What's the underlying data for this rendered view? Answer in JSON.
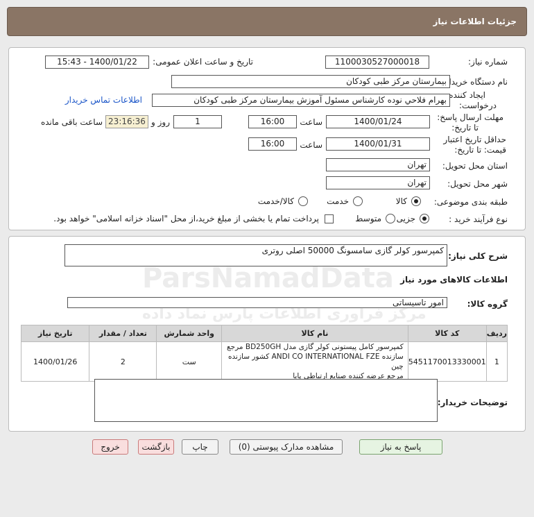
{
  "header": {
    "title": "جزئیات اطلاعات نیاز"
  },
  "form": {
    "need_number_label": "شماره نیاز:",
    "need_number": "1100030527000018",
    "announce_label": "تاریخ و ساعت اعلان عمومی:",
    "announce_value": "1400/01/22 - 15:43",
    "buyer_org_label": "نام دستگاه خریدار:",
    "buyer_org": "بیمارستان مرکز طبی کودکان",
    "creator_label_1": "ایجاد کننده",
    "creator_label_2": "درخواست:",
    "creator": "بهرام فلاحي نوده كارشناس مسئول آموزش بیمارستان مرکز طبی کودکان",
    "contact_link": "اطلاعات تماس خریدار",
    "deadline_label_1": "مهلت ارسال پاسخ:",
    "deadline_label_2": "تا تاریخ:",
    "deadline_date": "1400/01/24",
    "time_label": "ساعت",
    "deadline_time": "16:00",
    "days_value": "1",
    "days_label": "روز و",
    "remaining_value": "23:16:36",
    "remaining_label": "ساعت باقی مانده",
    "validity_label_1": "حداقل تاریخ اعتبار",
    "validity_label_2": "قیمت: تا تاریخ:",
    "validity_date": "1400/01/31",
    "validity_time": "16:00",
    "province_label": "استان محل تحویل:",
    "province": "تهران",
    "city_label": "شهر محل تحویل:",
    "city": "تهران",
    "category_label": "طبقه بندی موضوعی:",
    "category_options": [
      "کالا",
      "خدمت",
      "کالا/خدمت"
    ],
    "process_label": "نوع فرآیند خرید :",
    "process_options": [
      "جزیی",
      "متوسط"
    ],
    "payment_note": "پرداخت تمام یا بخشی از مبلغ خرید،از محل \"اسناد خزانه اسلامی\" خواهد بود."
  },
  "summary": {
    "desc_label": "شرح کلی نیاز:",
    "desc": "کمپرسور کولر گازی سامسونگ 50000 اصلی روتری",
    "items_title": "اطلاعات کالاهای مورد نیاز",
    "group_label": "گروه کالا:",
    "group": "امور تاسیساتی"
  },
  "table": {
    "headers": [
      "ردیف",
      "کد کالا",
      "نام کالا",
      "واحد شمارش",
      "تعداد / مقدار",
      "تاریخ نیاز"
    ],
    "rows": [
      {
        "row": "1",
        "code": "5451170013330001",
        "name_1": "کمپرسور کامل پیستونی کولر گازی مدل BD250GH مرجع",
        "name_2": "سازنده ANDI CO INTERNATIONAL FZE کشور سازنده چین",
        "name_3": "مرجع عرضه کننده صنایع ارتباطی پایا",
        "unit": "ست",
        "qty": "2",
        "date": "1400/01/26"
      }
    ]
  },
  "buyer_notes_label": "توضیحات خریدار:",
  "buttons": {
    "reply": "پاسخ به نیاز",
    "docs": "مشاهده مدارک پیوستی (0)",
    "print": "چاپ",
    "back": "بازگشت",
    "exit": "خروج"
  },
  "watermark": {
    "brand": "ParsNamadData",
    "tagline": "مرکز فراوری اطلاعات پارس نماد داده"
  }
}
